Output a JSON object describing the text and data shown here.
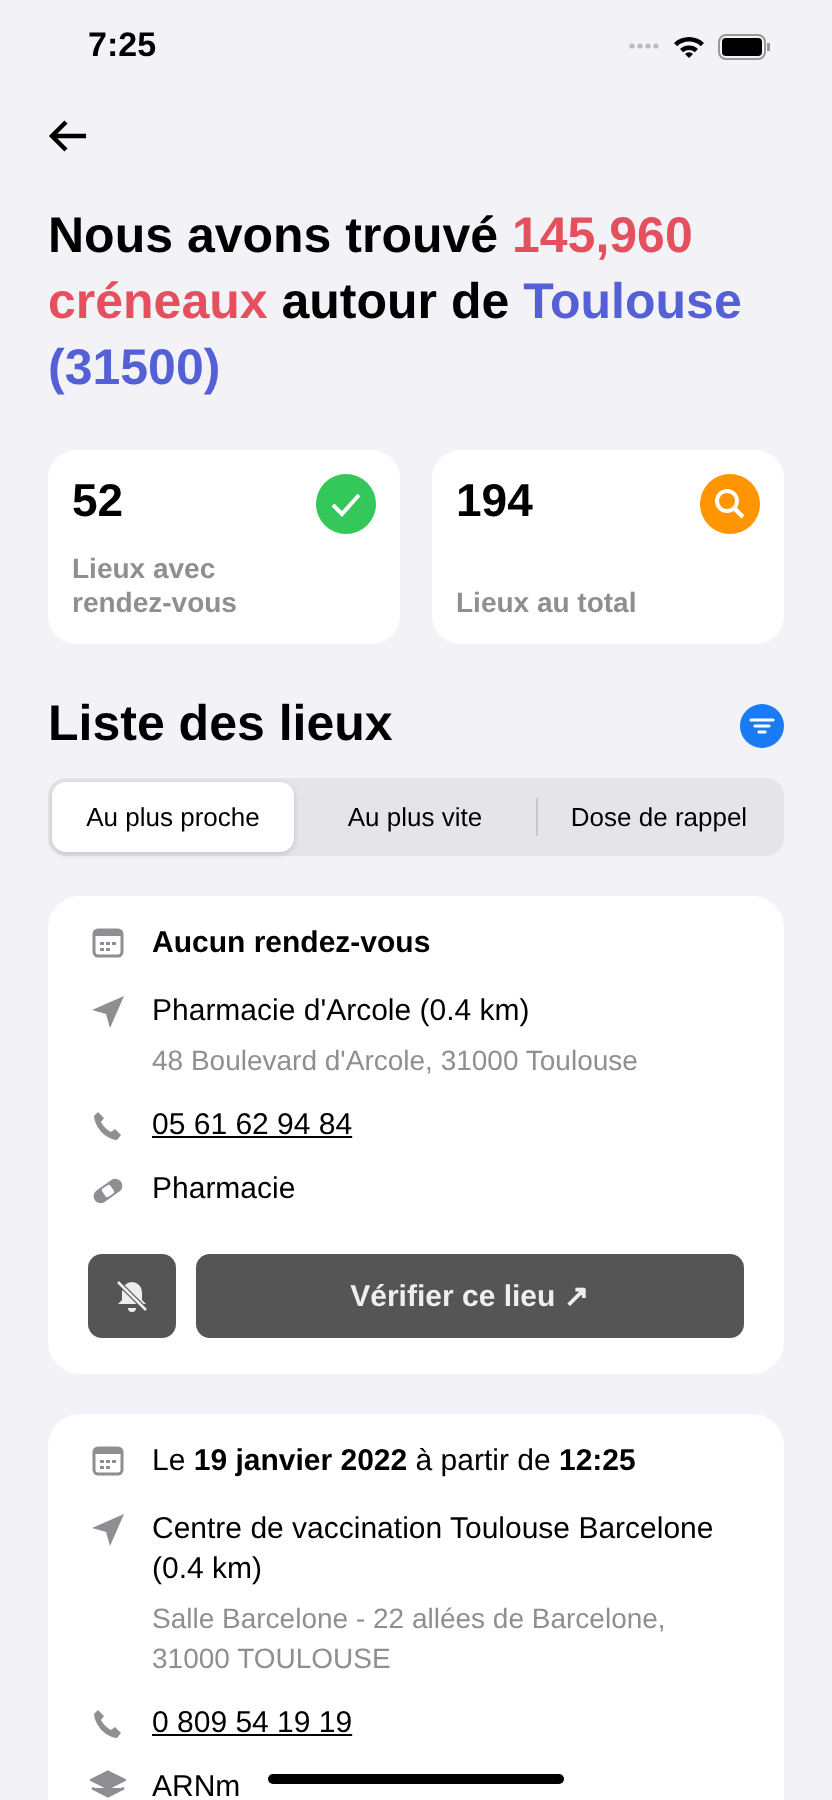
{
  "status_bar": {
    "time": "7:25"
  },
  "headline": [
    {
      "text": "Nous avons trouvé ",
      "kind": "plain"
    },
    {
      "text": "145,960 créneaux",
      "kind": "count"
    },
    {
      "text": " autour de ",
      "kind": "plain"
    },
    {
      "text": "Toulouse (31500)",
      "kind": "place"
    }
  ],
  "stats": [
    {
      "value": "52",
      "label": "Lieux avec rendez-vous",
      "kind": "check"
    },
    {
      "value": "194",
      "label": "Lieux au total",
      "kind": "search"
    }
  ],
  "list_title": "Liste des lieux",
  "tabs": [
    {
      "label": "Au plus proche",
      "selected": true
    },
    {
      "label": "Au plus vite",
      "selected": false
    },
    {
      "label": "Dose de rappel",
      "selected": false
    }
  ],
  "places": [
    {
      "appointment": {
        "text": "Aucun rendez-vous",
        "kind": "none"
      },
      "name": "Pharmacie d'Arcole (0.4 km)",
      "address": "48 Boulevard d'Arcole, 31000 Toulouse",
      "phone": "05 61 62 94 84",
      "type": {
        "text": "Pharmacie",
        "kind": "pharmacy"
      },
      "action": "Vérifier ce lieu ↗"
    },
    {
      "appointment": {
        "text": "Le **19 janvier 2022** à partir de **12:25**",
        "kind": "date"
      },
      "name": "Centre de vaccination Toulouse Barcelone (0.4 km)",
      "address": "Salle Barcelone - 22 allées de Barcelone, 31000 TOULOUSE",
      "phone": "0 809 54 19 19",
      "type": {
        "text": "ARNm",
        "kind": "vaccine"
      }
    }
  ]
}
